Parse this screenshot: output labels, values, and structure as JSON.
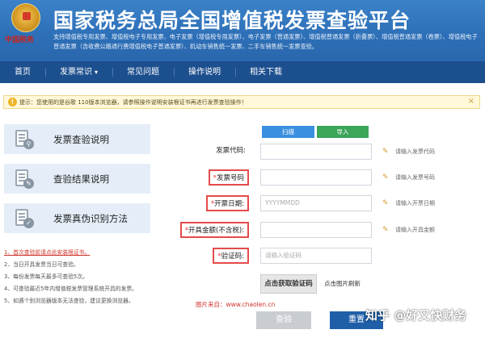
{
  "header": {
    "title": "国家税务总局全国增值税发票查验平台",
    "seal_text": "中国税务",
    "subtitle": "支持增值税专用发票、增值税电子专用发票、电子发票（增值税专用发票）、电子发票（普通发票）、增值税普通发票（折叠票）、增值税普通发票（卷票）、增值税电子普通发票（含收费公路通行费增值税电子普通发票）、机动车销售统一发票、二手车销售统一发票查验。"
  },
  "nav": {
    "items": [
      "首页",
      "发票常识",
      "常见问题",
      "操作说明",
      "相关下载"
    ]
  },
  "notice": {
    "text": "提示：您使用的是谷歌 110版本浏览器，请参照操作说明安装根证书再进行发票查验操作！",
    "close": "×"
  },
  "sidebar": {
    "items": [
      {
        "label": "发票查验说明",
        "icon": "search-document-icon"
      },
      {
        "label": "查验结果说明",
        "icon": "edit-document-icon"
      },
      {
        "label": "发票真伪识别方法",
        "icon": "shield-document-icon"
      }
    ]
  },
  "notes": {
    "lines": [
      "1、首次查验前请点此安装根证书。",
      "2、当日开具发票当日可查验。",
      "3、每份发票每天最多可查验5次。",
      "4、可查验最近5年内增值税发票管理系统开具的发票。",
      "5、如遇个别浏览器版本无法查验，建议更换浏览器。"
    ]
  },
  "form": {
    "scan_label": "扫描",
    "import_label": "导入",
    "fields": [
      {
        "label": "发票代码:",
        "required": false,
        "placeholder": "",
        "hint": "请输入发票代码"
      },
      {
        "label": "发票号码",
        "required": true,
        "placeholder": "",
        "hint": "请输入发票号码"
      },
      {
        "label": "开票日期:",
        "required": true,
        "placeholder": "YYYYMMDD",
        "hint": "请输入开票日期"
      },
      {
        "label": "开具金额(不含税):",
        "required": true,
        "placeholder": "",
        "hint": "请输入开具金额"
      },
      {
        "label": "验证码:",
        "required": true,
        "placeholder": "请输入验证码",
        "hint": ""
      }
    ],
    "captcha_text": "点击获取验证码",
    "refresh_label": "点击图片刷新",
    "check_label": "查验",
    "reset_label": "重置"
  },
  "source_note": "图片来自：www.chaolen.cn",
  "watermark": "知乎 @好又快财务",
  "colors": {
    "header_blue": "#2d6fb7",
    "nav_blue": "#1c4f8e",
    "required_red": "#e44b4b",
    "scan_blue": "#3a8fe0",
    "import_green": "#3ba55a"
  }
}
